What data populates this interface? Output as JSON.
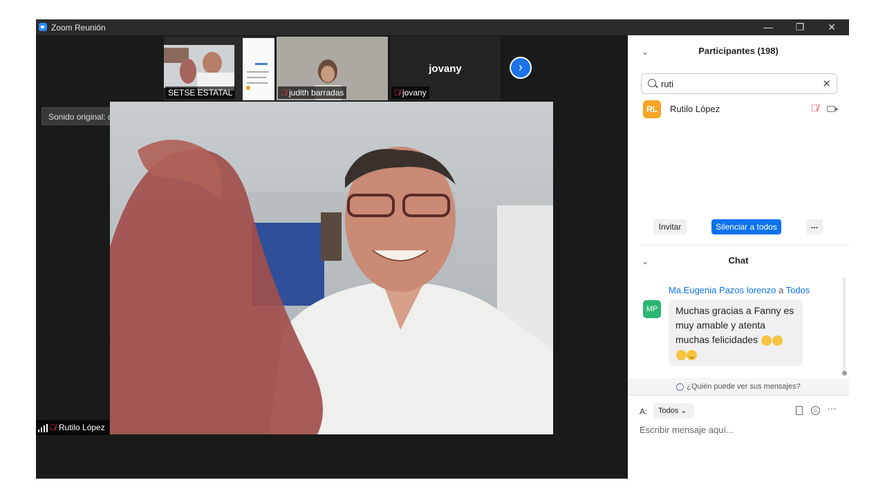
{
  "window": {
    "title": "Zoom Reunión",
    "min": "—",
    "max": "❐",
    "close": "✕"
  },
  "thumbnails": [
    {
      "name": "SETSE ESTATAL",
      "muted": false
    },
    {
      "name": "judith barradas",
      "muted": true
    },
    {
      "name": "jovany",
      "muted": true,
      "display_name": "jovany"
    }
  ],
  "next_arrow": "›",
  "audio": {
    "label": "Sonido original: desactivado",
    "arrow": "▼"
  },
  "active_speaker": {
    "name": "Rutilo López",
    "muted": true
  },
  "participants": {
    "title": "Participantes (198)",
    "search_value": "ruti",
    "clear": "✕",
    "list": [
      {
        "initials": "RL",
        "name": "Rutilo López",
        "avatar_color": "#f5a623"
      }
    ],
    "buttons": {
      "invite": "Invitar",
      "mute_all": "Silenciar a todos",
      "more": "..."
    }
  },
  "chat": {
    "title": "Chat",
    "messages": [
      {
        "sender": "Ma.Eugenia Pazos lorenzo",
        "to_word": "a",
        "recipient": "Todos",
        "initials": "MP",
        "line1": "Muchas gracias a Fanny es",
        "line2": "muy amable y atenta",
        "line3": "muchas felicidades"
      }
    ],
    "who_can_see": "¿Quién puede ver sus mensajes?",
    "to_label": "A:",
    "to_value": "Todos",
    "to_caret": "⌄",
    "more": "···",
    "input_placeholder": "Escribir mensaje aquí..."
  },
  "colors": {
    "accent": "#0e72ed",
    "muted_red": "#e0334a",
    "next_button": "#1a73e8"
  },
  "icons": [
    "zoom-icon",
    "mic-muted-icon",
    "video-icon",
    "search-icon",
    "signal-bars-icon",
    "file-icon",
    "emoji-icon",
    "chevron-down-icon",
    "arrow-right-icon",
    "clap-emoji",
    "smile-emoji",
    "user-icon"
  ]
}
